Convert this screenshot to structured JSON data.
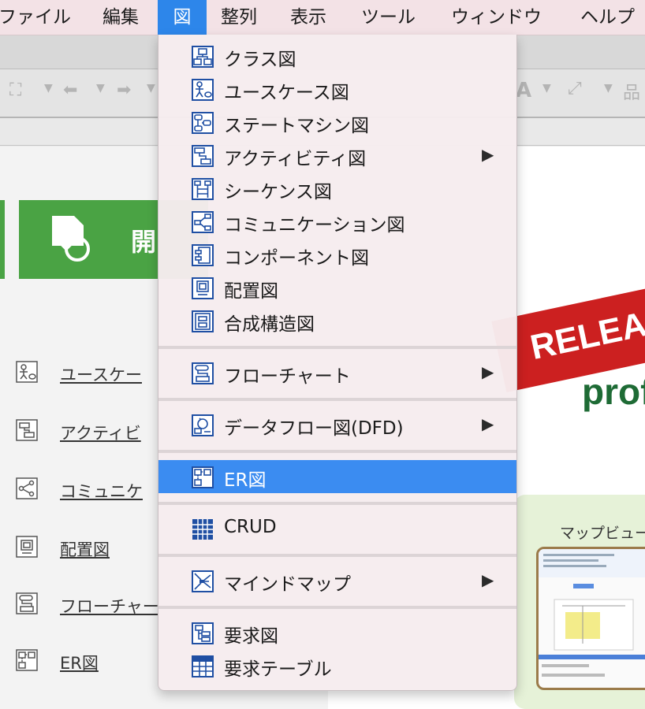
{
  "menubar": {
    "items": [
      {
        "label": "ファイル",
        "active": false
      },
      {
        "label": "編集",
        "active": false
      },
      {
        "label": "図",
        "active": true
      },
      {
        "label": "整列",
        "active": false
      },
      {
        "label": "表示",
        "active": false
      },
      {
        "label": "ツール",
        "active": false
      },
      {
        "label": "ウィンドウ",
        "active": false
      },
      {
        "label": "ヘルプ",
        "active": false
      }
    ]
  },
  "dropdown": {
    "items": [
      {
        "label": "クラス図",
        "icon": "class-diagram-icon",
        "submenu": false
      },
      {
        "label": "ユースケース図",
        "icon": "usecase-diagram-icon",
        "submenu": false
      },
      {
        "label": "ステートマシン図",
        "icon": "statemachine-diagram-icon",
        "submenu": false
      },
      {
        "label": "アクティビティ図",
        "icon": "activity-diagram-icon",
        "submenu": true
      },
      {
        "label": "シーケンス図",
        "icon": "sequence-diagram-icon",
        "submenu": false
      },
      {
        "label": "コミュニケーション図",
        "icon": "communication-diagram-icon",
        "submenu": false
      },
      {
        "label": "コンポーネント図",
        "icon": "component-diagram-icon",
        "submenu": false
      },
      {
        "label": "配置図",
        "icon": "deployment-diagram-icon",
        "submenu": false
      },
      {
        "label": "合成構造図",
        "icon": "composite-structure-icon",
        "submenu": false
      },
      {
        "label": "フローチャート",
        "icon": "flowchart-icon",
        "submenu": true
      },
      {
        "label": "データフロー図(DFD)",
        "icon": "dfd-icon",
        "submenu": true
      },
      {
        "label": "ER図",
        "icon": "er-diagram-icon",
        "submenu": false,
        "highlighted": true
      },
      {
        "label": "CRUD",
        "icon": "crud-icon",
        "submenu": false
      },
      {
        "label": "マインドマップ",
        "icon": "mindmap-icon",
        "submenu": true
      },
      {
        "label": "要求図",
        "icon": "requirement-diagram-icon",
        "submenu": false
      },
      {
        "label": "要求テーブル",
        "icon": "requirement-table-icon",
        "submenu": false
      }
    ],
    "submenu_arrow": "▶"
  },
  "left_panel": {
    "open_button_label": "開",
    "items": [
      {
        "label": "ユースケー",
        "icon": "usecase-diagram-icon"
      },
      {
        "label": "アクティビ",
        "icon": "activity-diagram-icon"
      },
      {
        "label": "コミュニケ",
        "icon": "communication-diagram-icon"
      },
      {
        "label": "配置図",
        "icon": "deployment-diagram-icon"
      },
      {
        "label": "フローチャー",
        "icon": "flowchart-icon"
      },
      {
        "label": "ER図",
        "icon": "er-diagram-icon"
      }
    ]
  },
  "right_panel": {
    "banner_text": "RELEA",
    "banner_sub": "prof",
    "map_view_label": "マップビュー"
  },
  "colors": {
    "menu_highlight": "#3b8cf1",
    "menubar_active": "#2d86ea",
    "icon_blue": "#1f4fa3",
    "open_green": "#4aa344",
    "banner_red": "#cc2020",
    "prof_green": "#1e6b35"
  }
}
